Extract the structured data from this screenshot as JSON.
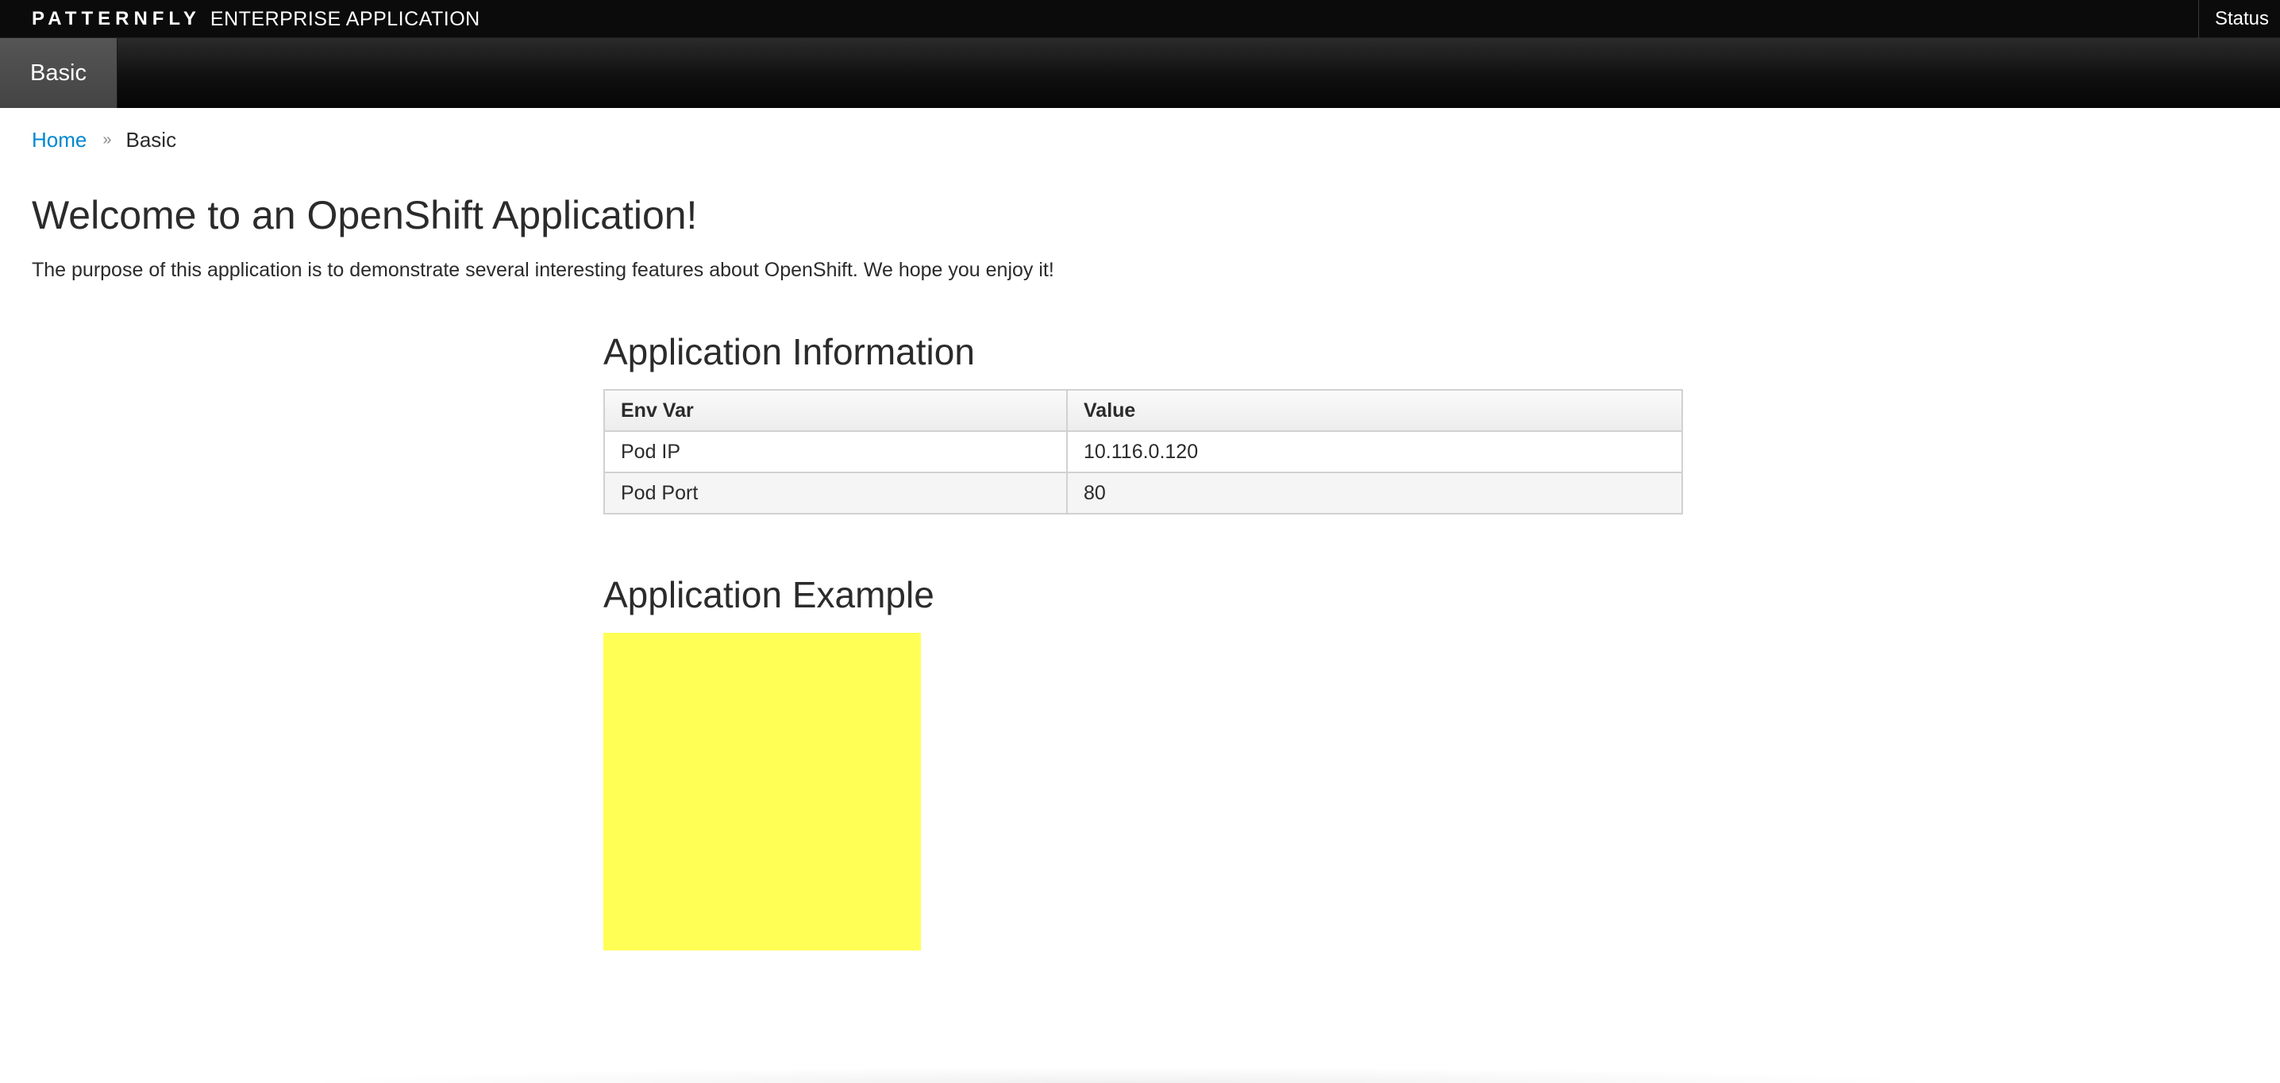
{
  "masthead": {
    "brand_logo": "PATTERNFLY",
    "brand_subtitle": "ENTERPRISE APPLICATION",
    "status_label": "Status"
  },
  "nav": {
    "items": [
      {
        "label": "Basic",
        "active": true
      }
    ]
  },
  "breadcrumb": {
    "home": "Home",
    "separator": "»",
    "current": "Basic"
  },
  "page": {
    "title": "Welcome to an OpenShift Application!",
    "intro": "The purpose of this application is to demonstrate several interesting features about OpenShift. We hope you enjoy it!"
  },
  "app_info": {
    "title": "Application Information",
    "columns": [
      "Env Var",
      "Value"
    ],
    "rows": [
      {
        "name": "Pod IP",
        "value": "10.116.0.120"
      },
      {
        "name": "Pod Port",
        "value": "80"
      }
    ]
  },
  "app_example": {
    "title": "Application Example",
    "box_color": "#ffff55"
  },
  "colors": {
    "link": "#0088ce",
    "masthead_bg": "#0b0b0b",
    "active_nav_bg": "#4a4a4a"
  }
}
